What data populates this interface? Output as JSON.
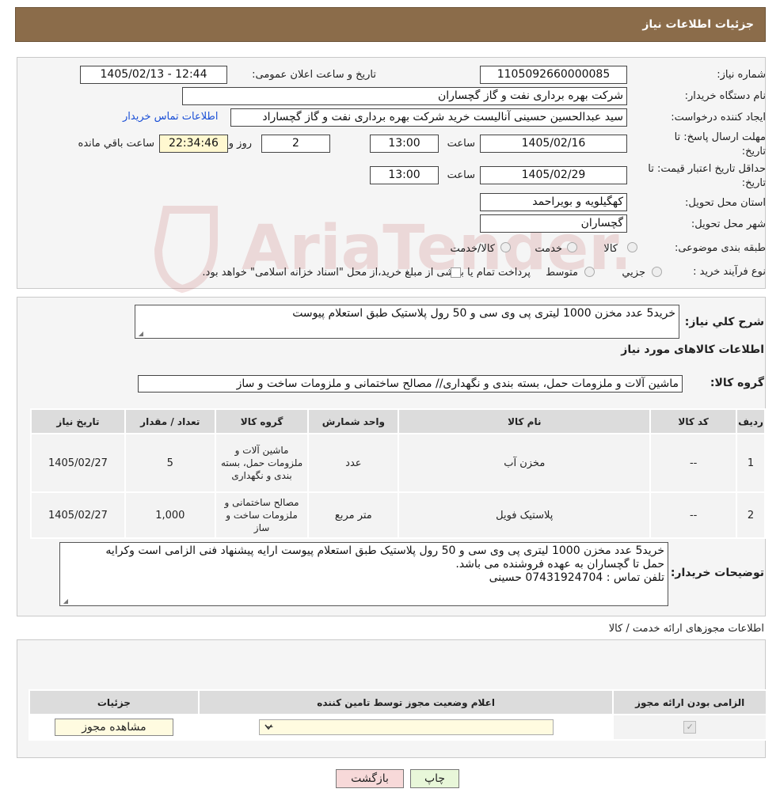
{
  "header": {
    "title": "جزئیات اطلاعات نیاز"
  },
  "form": {
    "need_number_label": "شماره نیاز:",
    "need_number": "1105092660000085",
    "announce_label": "تاریخ و ساعت اعلان عمومی:",
    "announce_value": "1405/02/13 - 12:44",
    "buyer_org_label": "نام دستگاه خریدار:",
    "buyer_org": "شرکت بهره برداری نفت و گاز گچساران",
    "creator_label": "ایجاد کننده درخواست:",
    "creator": "سید عبدالحسین حسینی آنالیست خرید شرکت بهره برداری نفت و گاز گچساراد",
    "contact_link": "اطلاعات تماس خریدار",
    "reply_deadline_label_1": "مهلت ارسال پاسخ: تا",
    "reply_deadline_label_2": "تاریخ:",
    "reply_date": "1405/02/16",
    "time_label": "ساعت",
    "reply_time": "13:00",
    "days_value": "2",
    "days_label": "روز و",
    "remaining_time": "22:34:46",
    "remaining_label": "ساعت باقي مانده",
    "price_validity_label_1": "حداقل تاریخ اعتبار قیمت: تا",
    "price_validity_label_2": "تاریخ:",
    "price_date": "1405/02/29",
    "price_time": "13:00",
    "province_label": "استان محل تحویل:",
    "province": "کهگیلویه و بویراحمد",
    "city_label": "شهر محل تحویل:",
    "city": "گچساران",
    "category_label": "طبقه بندی موضوعی:",
    "category_options": [
      "کالا",
      "خدمت",
      "کالا/خدمت"
    ],
    "process_label": "نوع فرآیند خرید :",
    "process_options": [
      "جزیي",
      "متوسط"
    ],
    "process_note": "پرداخت تمام یا بخشی از مبلغ خرید،از محل \"اسناد خزانه اسلامی\" خواهد بود."
  },
  "description": {
    "label": "شرح کلي نیاز:",
    "text": "خرید5 عدد مخزن 1000 لیتری پی وی سی و 50 رول پلاستیک طبق استعلام پیوست",
    "goods_info_title": "اطلاعات کالاهای مورد نیاز",
    "group_label": "گروه کالا:",
    "group_value": "ماشین آلات و ملزومات حمل، بسته بندی و نگهداری// مصالح ساختمانی و ملزومات ساخت و ساز"
  },
  "items_table": {
    "headers": [
      "ردیف",
      "کد کالا",
      "نام کالا",
      "واحد شمارش",
      "گروه کالا",
      "تعداد / مقدار",
      "تاریخ نیاز"
    ],
    "rows": [
      {
        "row": "1",
        "code": "--",
        "name": "مخزن آب",
        "unit": "عدد",
        "group": "ماشین آلات و ملزومات حمل، بسته بندی و نگهداری",
        "qty": "5",
        "date": "1405/02/27"
      },
      {
        "row": "2",
        "code": "--",
        "name": "پلاستیک فویل",
        "unit": "متر مربع",
        "group": "مصالح ساختمانی و ملزومات ساخت و ساز",
        "qty": "1,000",
        "date": "1405/02/27"
      }
    ]
  },
  "buyer_notes": {
    "label": "توضیحات خریدار:",
    "line1": "خرید5 عدد مخزن 1000 لیتری پی وی سی و 50 رول پلاستیک طبق استعلام پیوست ارایه پیشنهاد فنی الزامی است وکرایه",
    "line2": "حمل تا گچساران  به عهده فروشنده می باشد.",
    "line3": "تلفن تماس : 07431924704 حسینی"
  },
  "permits": {
    "title": "اطلاعات مجوزهای ارائه خدمت / کالا",
    "headers": [
      "الزامی بودن ارائه مجوز",
      "اعلام وضعیت مجوز توسط تامین کننده",
      "جزئیات"
    ],
    "select_value": "--",
    "view_button": "مشاهده مجوز"
  },
  "footer": {
    "print_button": "چاپ",
    "back_button": "بازگشت"
  },
  "watermark": {
    "text": "AriaTender.neT"
  },
  "colors": {
    "header_bg": "#8b6c4a",
    "link": "#1a4fd6",
    "back_button_bg": "#f7d9d9",
    "print_button_bg": "#e8f7d9"
  }
}
